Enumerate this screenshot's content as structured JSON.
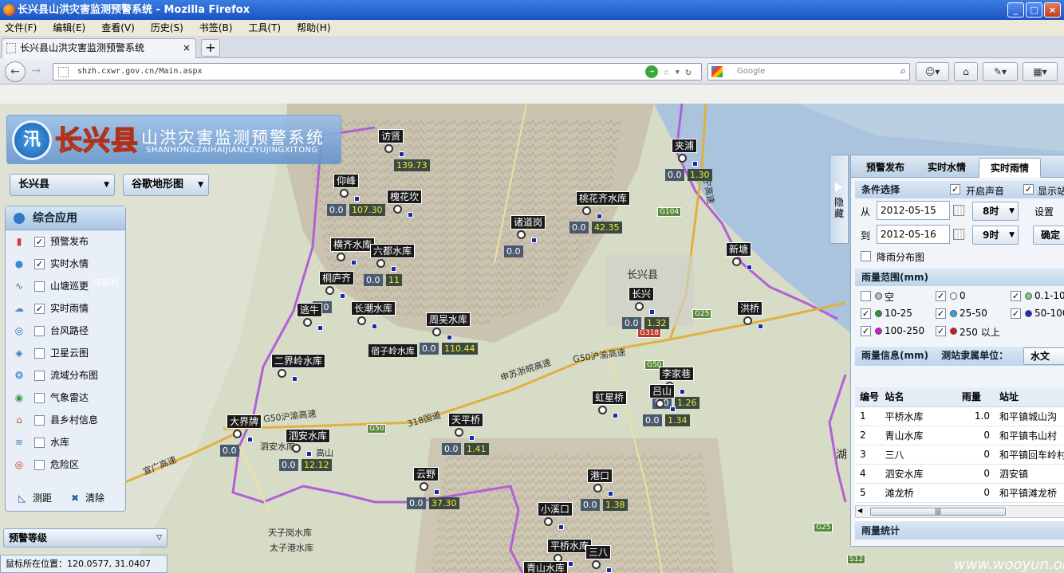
{
  "window": {
    "title": "长兴县山洪灾害监测预警系统 - Mozilla Firefox"
  },
  "menu": [
    "文件(F)",
    "编辑(E)",
    "查看(V)",
    "历史(S)",
    "书签(B)",
    "工具(T)",
    "帮助(H)"
  ],
  "tab": {
    "title": "长兴县山洪灾害监测预警系统",
    "close": "×",
    "new_tab": "+"
  },
  "nav": {
    "url": "shzh.cxwr.gov.cn/Main.aspx",
    "search_placeholder": "Google",
    "back": "←",
    "forward": "→",
    "home": "⌂"
  },
  "app": {
    "logo_char": "汛",
    "county_name": "长兴县",
    "system_name": "山洪灾害监测预警系统",
    "pinyin": "SHANHONGZAIHAIJIANCEYUJINGXITONG",
    "region_select": "长兴县",
    "map_type_select": "谷歌地形图",
    "left_panel": {
      "title": "综合应用",
      "items": [
        {
          "label": "预警发布",
          "checked": true,
          "icon": "alarm-icon",
          "glyph": "▮",
          "color": "#d23a2a"
        },
        {
          "label": "实时水情",
          "checked": true,
          "icon": "water-drop-icon",
          "glyph": "●",
          "color": "#3a8ad8"
        },
        {
          "label": "山塘巡更",
          "checked": false,
          "icon": "patrol-chart-icon",
          "glyph": "∿",
          "color": "#4a7a3a"
        },
        {
          "label": "实时雨情",
          "checked": true,
          "icon": "rain-cloud-icon",
          "glyph": "☁",
          "color": "#5a88c0"
        },
        {
          "label": "台风路径",
          "checked": false,
          "icon": "typhoon-icon",
          "glyph": "◎",
          "color": "#2a6ac8"
        },
        {
          "label": "卫星云图",
          "checked": false,
          "icon": "satellite-icon",
          "glyph": "◈",
          "color": "#3a7ab8"
        },
        {
          "label": "流域分布图",
          "checked": false,
          "icon": "basin-icon",
          "glyph": "❂",
          "color": "#2a78c8"
        },
        {
          "label": "气象雷达",
          "checked": false,
          "icon": "radar-icon",
          "glyph": "◉",
          "color": "#3a9a4a"
        },
        {
          "label": "县乡村信息",
          "checked": false,
          "icon": "house-icon",
          "glyph": "⌂",
          "color": "#c8502a"
        },
        {
          "label": "水库",
          "checked": false,
          "icon": "reservoir-icon",
          "glyph": "≋",
          "color": "#3a88b0"
        },
        {
          "label": "危险区",
          "checked": false,
          "icon": "danger-target-icon",
          "glyph": "◎",
          "color": "#c8301a"
        }
      ],
      "measure": "测距",
      "clear": "清除"
    },
    "warning_level": "预警等级",
    "coord_label": "鼠标所在位置：120.0577, 31.0407",
    "hide_button": "隐藏"
  },
  "right_panel": {
    "tabs": [
      "预警发布",
      "实时水情",
      "实时雨情"
    ],
    "active_tab": "实时雨情",
    "condition_title": "条件选择",
    "sound_label": "开启声音",
    "show_label": "显示站",
    "from_label": "从",
    "to_label": "到",
    "from_date": "2012-05-15",
    "to_date": "2012-05-16",
    "from_hour": "8时",
    "to_hour": "9时",
    "settings_label": "设置",
    "confirm": "确定",
    "distribution_label": "降雨分布图",
    "range_title": "雨量范围(mm)",
    "ranges": [
      {
        "label": "空",
        "checked": false,
        "color": "#bbbbbb"
      },
      {
        "label": "0",
        "checked": true,
        "color": "#ffffff"
      },
      {
        "label": "0.1-10",
        "checked": true,
        "color": "#7ad07a"
      },
      {
        "label": "10-25",
        "checked": true,
        "color": "#2a9a2a"
      },
      {
        "label": "25-50",
        "checked": true,
        "color": "#3aa0e8"
      },
      {
        "label": "50-100",
        "checked": true,
        "color": "#1a2ac8"
      },
      {
        "label": "100-250",
        "checked": true,
        "color": "#d21ad2"
      },
      {
        "label": "250 以上",
        "checked": true,
        "color": "#d21a1a"
      }
    ],
    "info_title": "雨量信息(mm)",
    "unit_label": "测站隶属单位：",
    "unit_value": "水文",
    "table_headers": [
      "编号",
      "站名",
      "雨量",
      "站址"
    ],
    "table_rows": [
      [
        "1",
        "平桥水库",
        "1.0",
        "和平镇城山沟"
      ],
      [
        "2",
        "青山水库",
        "0",
        "和平镇韦山村"
      ],
      [
        "3",
        "三八",
        "0",
        "和平镇回车岭村"
      ],
      [
        "4",
        "泗安水库",
        "0",
        "泗安镇"
      ],
      [
        "5",
        "滩龙桥",
        "0",
        "和平镇滩龙桥"
      ],
      [
        "6",
        "桃花齐水库",
        "0",
        "龙山街道川步村"
      ]
    ],
    "stats_title": "雨量统计"
  },
  "stations": [
    {
      "name": "访贤",
      "v0": null,
      "vr": "139.73"
    },
    {
      "name": "仰峰",
      "v0": "0.0",
      "vr": "107.30"
    },
    {
      "name": "槐花坎",
      "v0": null,
      "vr": null
    },
    {
      "name": "夹浦",
      "v0": "0.0",
      "vr": "1.30"
    },
    {
      "name": "桃花齐水库",
      "v0": "0.0",
      "vr": "42.35"
    },
    {
      "name": "诸道岗",
      "v0": "0.0",
      "vr": null
    },
    {
      "name": "横齐水库",
      "v0": null,
      "vr": null
    },
    {
      "name": "六都水库",
      "v0": "0.0",
      "vr": "11"
    },
    {
      "name": "桐庐齐",
      "v0": "0.0",
      "vr": null
    },
    {
      "name": "逃牛",
      "v0": null,
      "vr": null
    },
    {
      "name": "长潮水库",
      "v0": null,
      "vr": null
    },
    {
      "name": "周吴水库",
      "v0": "0.0",
      "vr": "110.44"
    },
    {
      "name": "长兴",
      "v0": "0.0",
      "vr": "1.32"
    },
    {
      "name": "新塘",
      "v0": null,
      "vr": null
    },
    {
      "name": "洪桥",
      "v0": null,
      "vr": null
    },
    {
      "name": "二界岭水库",
      "v0": null,
      "vr": null
    },
    {
      "name": "李家巷",
      "v0": "0.0",
      "vr": "1.26"
    },
    {
      "name": "吕山",
      "v0": "0.0",
      "vr": "1.34"
    },
    {
      "name": "虹星桥",
      "v0": null,
      "vr": null
    },
    {
      "name": "大界牌",
      "v0": "0.0",
      "vr": null
    },
    {
      "name": "泗安水库",
      "v0": "0.0",
      "vr": "12.12"
    },
    {
      "name": "天平桥",
      "v0": "0.0",
      "vr": "1.41"
    },
    {
      "name": "云野",
      "v0": "0.0",
      "vr": "37.30"
    },
    {
      "name": "港口",
      "v0": "0.0",
      "vr": "1.38"
    },
    {
      "name": "小溪口",
      "v0": null,
      "vr": null
    },
    {
      "name": "平桥水库",
      "v0": null,
      "vr": null
    },
    {
      "name": "三八",
      "v0": null,
      "vr": null
    },
    {
      "name": "青山水库",
      "v0": null,
      "vr": null
    }
  ],
  "map_labels": {
    "county": "长兴县",
    "roads": [
      "G104",
      "G25",
      "G318",
      "G50",
      "G50",
      "G25",
      "S12"
    ],
    "road_texts": [
      "G50沪渝高速",
      "申苏浙皖高速",
      "G50沪渝高速",
      "318国道",
      "宣广高速",
      "杭宁高速"
    ],
    "places": [
      "许家村",
      "泗安水库",
      "天子岗水库",
      "太子港水库",
      "湖",
      "高山"
    ],
    "partial": "宿子岭水库"
  },
  "watermark": "www.wooyun.org"
}
